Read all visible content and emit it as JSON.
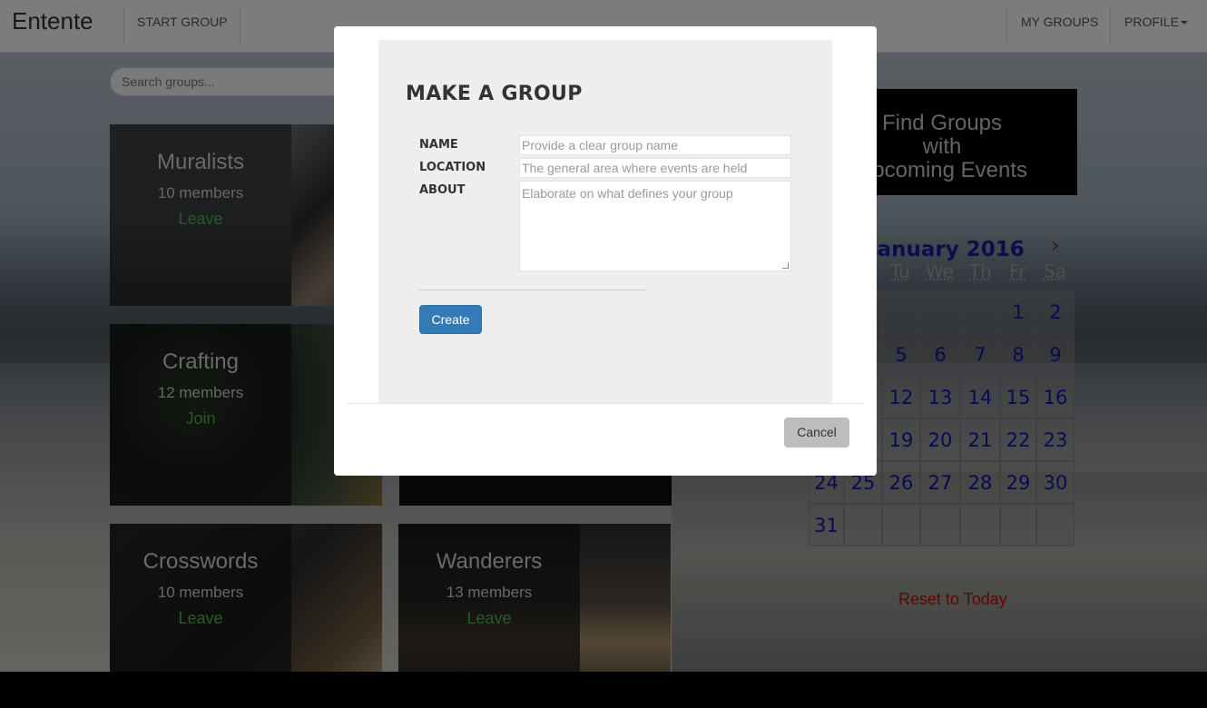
{
  "navbar": {
    "brand": "Entente",
    "start_group": "START GROUP",
    "my_groups": "MY GROUPS",
    "profile": "PROFILE"
  },
  "search": {
    "placeholder": "Search groups..."
  },
  "groups": [
    {
      "name": "Muralists",
      "members": "10 members",
      "action": "Leave"
    },
    {
      "name": "Crafting",
      "members": "12 members",
      "action": "Join"
    },
    {
      "name": "Crosswords",
      "members": "10 members",
      "action": "Leave"
    },
    {
      "name": "Wanderers",
      "members": "13 members",
      "action": "Leave"
    }
  ],
  "promo": {
    "line1": "Find Groups",
    "line2": "with",
    "line3": "Upcoming Events"
  },
  "calendar": {
    "title": "January 2016",
    "days_of_week": [
      "Tu",
      "We",
      "Th",
      "Fr",
      "Sa"
    ],
    "days": [
      "",
      "",
      "",
      "",
      "",
      "1",
      "2",
      "",
      "",
      "5",
      "6",
      "7",
      "8",
      "9",
      "",
      "",
      "12",
      "13",
      "14",
      "15",
      "16",
      "",
      "",
      "19",
      "20",
      "21",
      "22",
      "23",
      "24",
      "25",
      "26",
      "27",
      "28",
      "29",
      "30",
      "31",
      "",
      "",
      "",
      "",
      "",
      ""
    ],
    "reset": "Reset to Today"
  },
  "modal": {
    "title": "MAKE A GROUP",
    "name_label": "NAME",
    "name_placeholder": "Provide a clear group name",
    "location_label": "LOCATION",
    "location_placeholder": "The general area where events are held",
    "about_label": "ABOUT",
    "about_placeholder": "Elaborate on what defines your group",
    "create_label": "Create",
    "cancel_label": "Cancel"
  },
  "colors": {
    "primary_button": "#337ab7",
    "join_leave": "#4cb64c",
    "calendar_text": "#1414a8",
    "reset_link": "#b01010"
  }
}
